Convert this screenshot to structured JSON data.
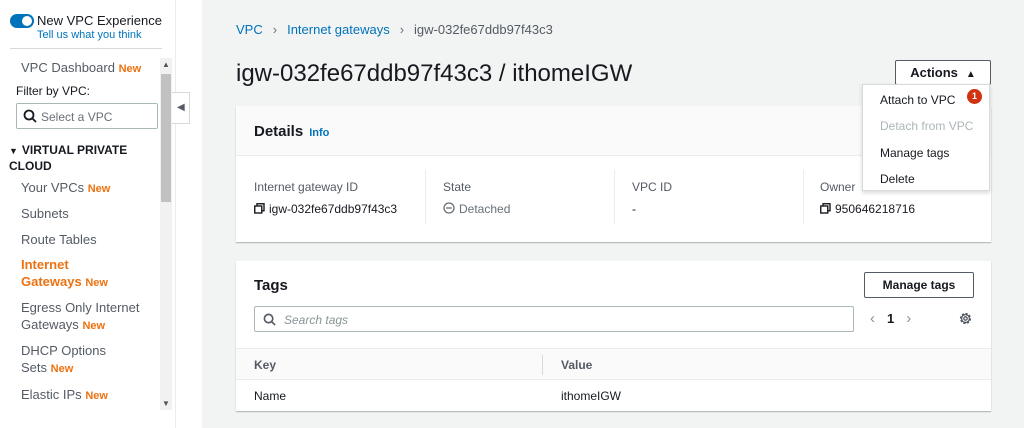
{
  "sidebar": {
    "vpc_experience": {
      "title": "New VPC Experience",
      "feedback_link": "Tell us what you think"
    },
    "dashboard": {
      "label": "VPC Dashboard",
      "badge": "New"
    },
    "filter_label": "Filter by VPC:",
    "filter_placeholder": "Select a VPC",
    "section_title": "VIRTUAL PRIVATE CLOUD",
    "items": [
      {
        "label": "Your VPCs",
        "badge": "New"
      },
      {
        "label": "Subnets",
        "badge": ""
      },
      {
        "label": "Route Tables",
        "badge": ""
      },
      {
        "label": "Internet Gateways",
        "badge": "New",
        "active": true
      },
      {
        "label": "Egress Only Internet Gateways",
        "badge": "New"
      },
      {
        "label": "DHCP Options Sets",
        "badge": "New"
      },
      {
        "label": "Elastic IPs",
        "badge": "New"
      }
    ]
  },
  "breadcrumb": [
    {
      "label": "VPC",
      "link": true
    },
    {
      "label": "Internet gateways",
      "link": true
    },
    {
      "label": "igw-032fe67ddb97f43c3",
      "link": false
    }
  ],
  "page_title": "igw-032fe67ddb97f43c3 / ithomeIGW",
  "actions": {
    "label": "Actions",
    "menu": [
      {
        "label": "Attach to VPC",
        "enabled": true,
        "badge": "1"
      },
      {
        "label": "Detach from VPC",
        "enabled": false
      },
      {
        "label": "Manage tags",
        "enabled": true
      },
      {
        "label": "Delete",
        "enabled": true
      }
    ]
  },
  "details": {
    "title": "Details",
    "info_link": "Info",
    "fields": [
      {
        "label": "Internet gateway ID",
        "value": "igw-032fe67ddb97f43c3"
      },
      {
        "label": "State",
        "value": "Detached"
      },
      {
        "label": "VPC ID",
        "value": "-"
      },
      {
        "label": "Owner",
        "value": "950646218716"
      }
    ]
  },
  "tags": {
    "title": "Tags",
    "manage_button": "Manage tags",
    "search_placeholder": "Search tags",
    "page": "1",
    "columns": [
      "Key",
      "Value"
    ],
    "rows": [
      {
        "key": "Name",
        "value": "ithomeIGW"
      }
    ]
  },
  "colors": {
    "link": "#0073bb",
    "new_badge": "#ec7211",
    "alert_badge": "#d13212"
  }
}
